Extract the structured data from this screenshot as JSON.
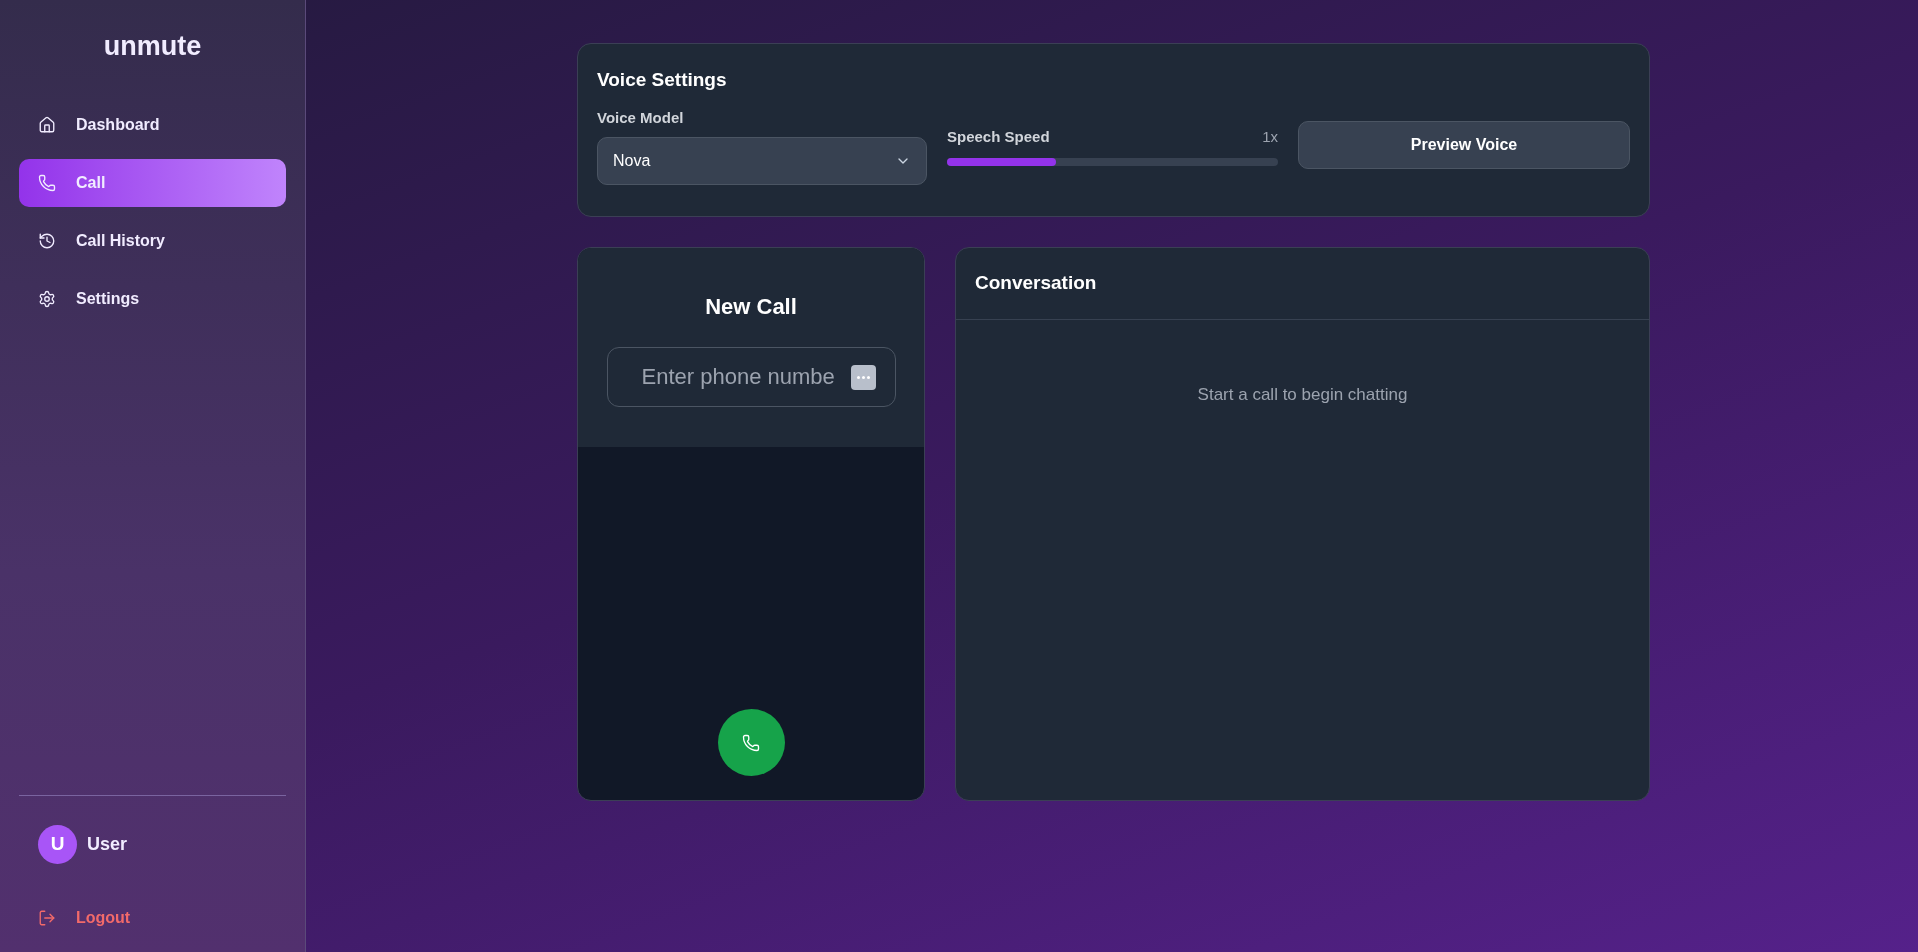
{
  "sidebar": {
    "logo": "unmute",
    "items": [
      {
        "label": "Dashboard",
        "selected": false
      },
      {
        "label": "Call",
        "selected": true
      },
      {
        "label": "Call History",
        "selected": false
      },
      {
        "label": "Settings",
        "selected": false
      }
    ],
    "user": {
      "initial": "U",
      "name": "User"
    },
    "logout": "Logout"
  },
  "voice_settings": {
    "title": "Voice Settings",
    "model_label": "Voice Model",
    "model_value": "Nova",
    "speed_label": "Speech Speed",
    "speed_reading": "1x",
    "speed": {
      "level": 0.33
    },
    "preview_button": "Preview Voice"
  },
  "new_call": {
    "title": "New Call",
    "placeholder": "Enter phone numbe"
  },
  "conversation": {
    "title": "Conversation",
    "empty_text": "Start a call to begin chatting"
  }
}
